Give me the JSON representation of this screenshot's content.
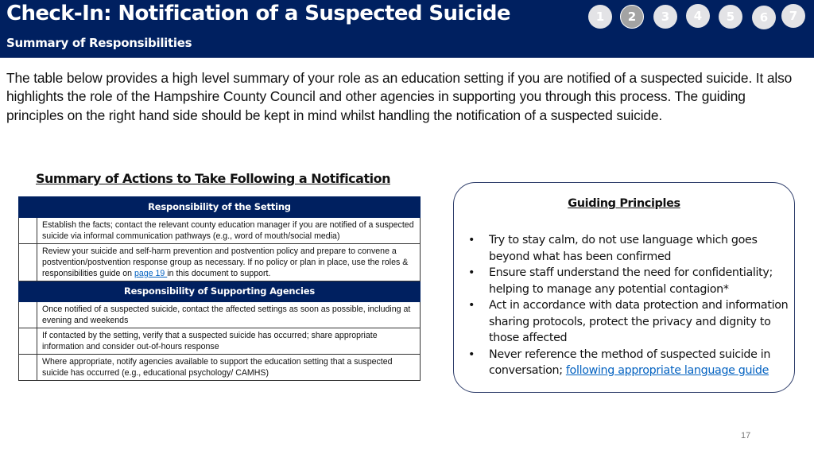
{
  "header": {
    "title": "Check-In: Notification of a Suspected Suicide",
    "subtitle": "Summary of Responsibilities",
    "steps": [
      {
        "label": "1",
        "active": false
      },
      {
        "label": "2",
        "active": true
      },
      {
        "label": "3",
        "active": false
      },
      {
        "label": "4",
        "active": false
      },
      {
        "label": "5",
        "active": false
      },
      {
        "label": "6",
        "active": false
      },
      {
        "label": "7",
        "active": false
      }
    ]
  },
  "intro": "The table below provides a high level summary of your role as an education setting if you are notified of a suspected suicide. It also highlights the role of the Hampshire County Council and other agencies in supporting you through this process. The guiding principles on the right hand side should be kept in mind whilst handling the notification of a suspected suicide.",
  "summary": {
    "title": "Summary of Actions to Take Following a Notification",
    "setting": {
      "heading": "Responsibility of the Setting",
      "rows": [
        {
          "text": "Establish the facts; contact the relevant county education manager if you are notified of a suspected suicide via informal communication pathways (e.g., word of mouth/social media)"
        },
        {
          "text_before": "Review your suicide and self-harm prevention and postvention policy and prepare to convene a postvention/postvention response group as necessary. If no policy or plan in place, use the roles & responsibilities guide on ",
          "link": "page 19 ",
          "text_after": "in this document to support."
        }
      ]
    },
    "agencies": {
      "heading": "Responsibility of Supporting Agencies",
      "rows": [
        {
          "text": "Once notified of a suspected suicide, contact the affected settings as soon as possible, including at evening and weekends"
        },
        {
          "text": "If contacted by the setting, verify that a suspected suicide has occurred; share appropriate information and consider out-of-hours response"
        },
        {
          "text": "Where appropriate, notify agencies available to support the education setting that a suspected suicide has occurred (e.g., educational psychology/ CAMHS)"
        }
      ]
    }
  },
  "principles": {
    "title": "Guiding Principles",
    "bullet": "•",
    "items": [
      {
        "text": "Try to stay calm, do not use language which goes beyond what has been confirmed"
      },
      {
        "text": "Ensure staff understand the need for confidentiality; helping to manage any potential contagion*"
      },
      {
        "text": "Act in accordance with data protection and information sharing protocols, protect the privacy and dignity to those affected"
      },
      {
        "text": "Never reference the method of suspected suicide in conversation; ",
        "link": "following appropriate language guide"
      }
    ]
  },
  "page_number": "17",
  "colors": {
    "header_bg": "#002060",
    "step_inactive": "#e3e3e6",
    "step_active": "#a3a3a3",
    "link": "#0563c1"
  }
}
